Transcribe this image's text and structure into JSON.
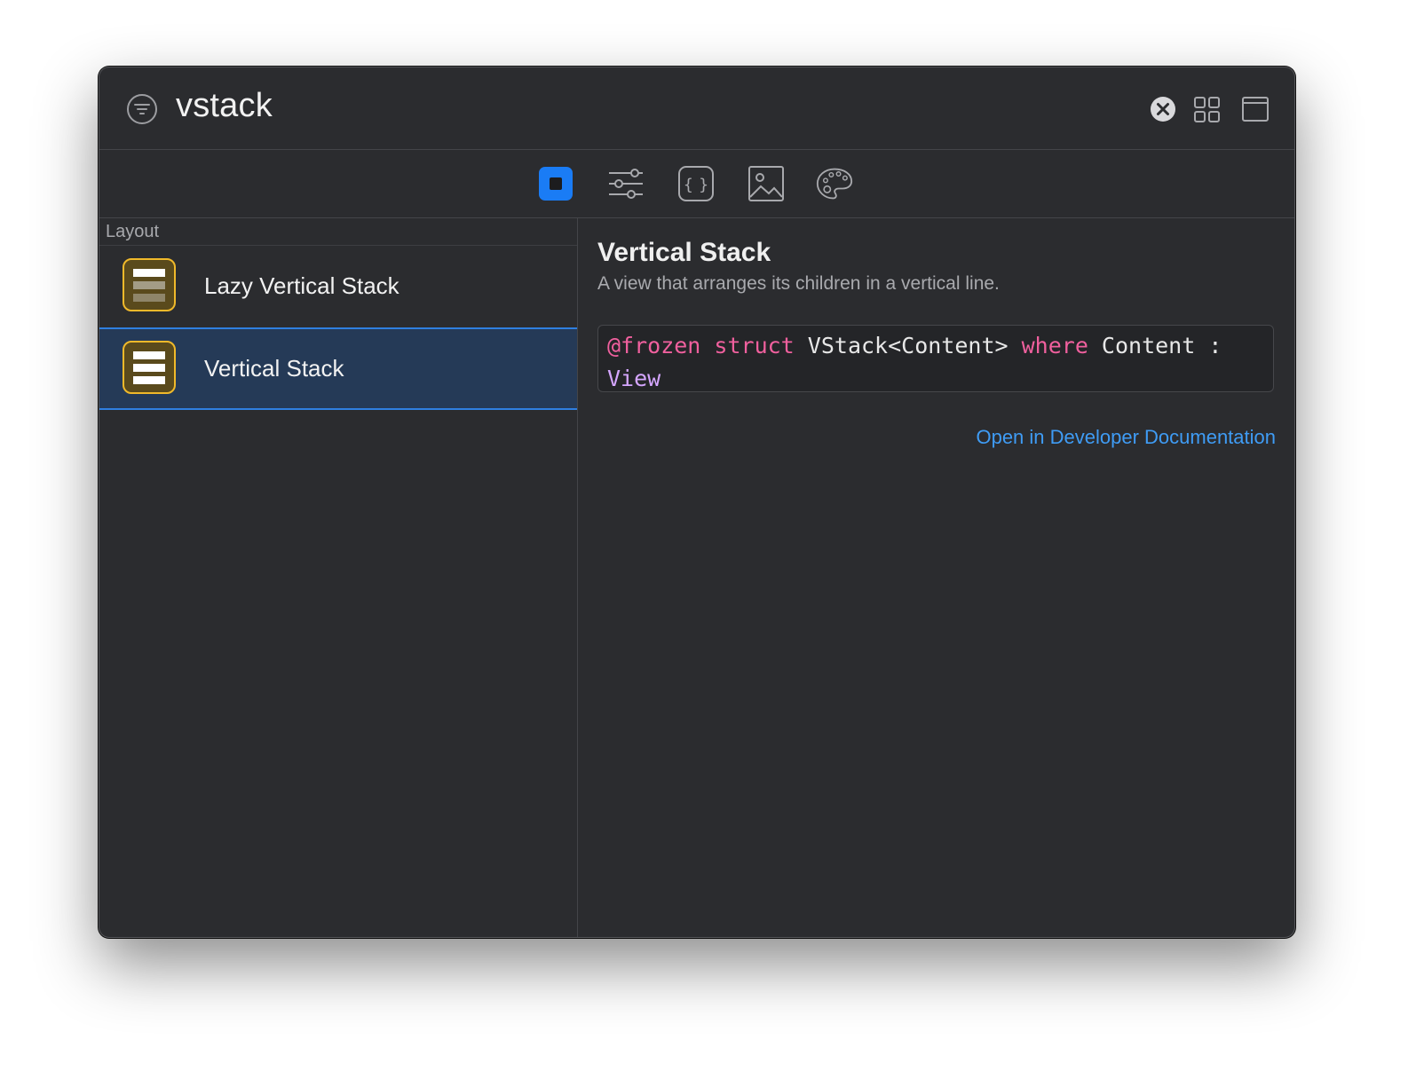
{
  "search": {
    "query": "vstack",
    "filter_icon": "filter-icon",
    "clear_icon": "clear-circle-icon",
    "grid_icon": "grid-view-icon",
    "panel_icon": "panel-window-icon"
  },
  "tabs": [
    {
      "name": "views",
      "icon": "square-stop-icon",
      "active": true
    },
    {
      "name": "modifiers",
      "icon": "sliders-icon",
      "active": false
    },
    {
      "name": "snippets",
      "icon": "curly-braces-icon",
      "active": false
    },
    {
      "name": "media",
      "icon": "photo-icon",
      "active": false
    },
    {
      "name": "colors",
      "icon": "palette-icon",
      "active": false
    }
  ],
  "sidebar": {
    "section": "Layout",
    "items": [
      {
        "label": "Lazy Vertical Stack",
        "icon": "lazy-vstack-icon",
        "selected": false
      },
      {
        "label": "Vertical Stack",
        "icon": "vstack-icon",
        "selected": true
      }
    ]
  },
  "detail": {
    "title": "Vertical Stack",
    "summary": "A view that arranges its children in a vertical line.",
    "declaration": {
      "t1": "@frozen",
      "t2": " ",
      "t3": "struct",
      "t4": " VStack<Content> ",
      "t5": "where",
      "t6": " Content : ",
      "t7": "View"
    },
    "link": "Open in Developer Documentation"
  },
  "colors": {
    "accent": "#1a7cf5",
    "link": "#3f9cf5",
    "keyword": "#f0609e",
    "type": "#d5a6ff",
    "icon_fill": "#f0b92a",
    "selection": "#253a57"
  }
}
